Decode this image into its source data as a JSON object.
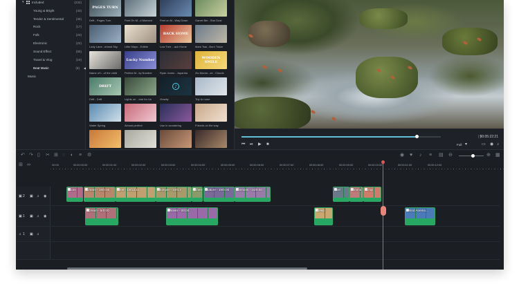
{
  "sidebar": {
    "items": [
      {
        "label": "Included",
        "count": "(232)"
      },
      {
        "label": "Young & Bright",
        "count": "(43)"
      },
      {
        "label": "Tender & Sentimental",
        "count": "(36)"
      },
      {
        "label": "Rock",
        "count": "(17)"
      },
      {
        "label": "Folk",
        "count": "(23)"
      },
      {
        "label": "Electronic",
        "count": "(22)"
      },
      {
        "label": "Sound Effect",
        "count": "(65)"
      },
      {
        "label": "Travel & Vlog",
        "count": "(19)"
      },
      {
        "label": "Beat Music",
        "count": "(8)"
      },
      {
        "label": "Music",
        "count": ""
      }
    ]
  },
  "media": {
    "tiles": [
      {
        "caption": "Drift - Pages Turn",
        "thumb_text": "PAGES TURN",
        "color": "#3a4a52",
        "color2": "#9fb2bc"
      },
      {
        "caption": "Feet On M...d Moment",
        "thumb_text": "",
        "color": "#5d6f7a",
        "color2": "#c8d3d8"
      },
      {
        "caption": "Feet on M...Way Down",
        "thumb_text": "",
        "color": "#2d3e5a",
        "color2": "#6a8ab0"
      },
      {
        "caption": "Garret Ber...Star Dust",
        "thumb_text": "",
        "color": "#6b8b5e",
        "color2": "#c9d0a0"
      },
      {
        "caption": "Lady Lane...erland Sky",
        "thumb_text": "",
        "color": "#4a5d72",
        "color2": "#9ab0c4"
      },
      {
        "caption": "Little Mayo - Edible",
        "thumb_text": "",
        "color": "#e8e0d0",
        "color2": "#a09080"
      },
      {
        "caption": "Low Tree ...ack Home",
        "thumb_text": "BACK HOME",
        "color": "#b83a2e",
        "color2": "#e8c8a0"
      },
      {
        "caption": "Mark Tsai...Born Twice",
        "thumb_text": "",
        "color": "#6a7a8a",
        "color2": "#c0b8a8"
      },
      {
        "caption": "Name of t...of the child",
        "thumb_text": "",
        "color": "#e8e4dc",
        "color2": "#6a6a6a"
      },
      {
        "caption": "Perfect M...ky Number",
        "thumb_text": "Lucky Number",
        "color": "#3a3f8a",
        "color2": "#8a8fd8"
      },
      {
        "caption": "Ryan Jones - Japanba",
        "thumb_text": "",
        "color": "#2a2e34",
        "color2": "#5a3e3e"
      },
      {
        "caption": "Zio Moran...ze - Clouds",
        "thumb_text": "WOODEN SMILE",
        "color": "#e0b43a",
        "color2": "#f4d87a"
      },
      {
        "caption": "Drift - Drift",
        "thumb_text": "DRIFT",
        "color": "#4a7a6a",
        "color2": "#a8c8b0"
      },
      {
        "caption": "Lights on ...ime for Us",
        "thumb_text": "",
        "color": "#3a4a3a",
        "color2": "#8aa88a"
      },
      {
        "caption": "Gravity",
        "thumb_text": "",
        "color": "#14202a",
        "color2": "#1c3440"
      },
      {
        "caption": "Trip to rome",
        "thumb_text": "",
        "color": "#a8b8c8",
        "color2": "#e0e6ea"
      },
      {
        "caption": "Water Spring",
        "thumb_text": "",
        "color": "#5a8ab0",
        "color2": "#d0e0ea"
      },
      {
        "caption": "Almost perfect",
        "thumb_text": "",
        "color": "#c86a7a",
        "color2": "#f0c8d0"
      },
      {
        "caption": "Use in wondering",
        "thumb_text": "",
        "color": "#2a2e5a",
        "color2": "#8a5a9a"
      },
      {
        "caption": "Friends on the way",
        "thumb_text": "",
        "color": "#c8a88a",
        "color2": "#f0e0d0"
      },
      {
        "caption": "",
        "thumb_text": "",
        "color": "#c8783a",
        "color2": "#f4c06a"
      },
      {
        "caption": "",
        "thumb_text": "",
        "color": "#a8a8a0",
        "color2": "#e0e0d8"
      },
      {
        "caption": "",
        "thumb_text": "",
        "color": "#6a4a3a",
        "color2": "#c89878"
      },
      {
        "caption": "",
        "thumb_text": "",
        "color": "#3a2a2a",
        "color2": "#a88868"
      }
    ]
  },
  "preview": {
    "timecode": "00:05:22:21",
    "quality": "Full",
    "brackets": "{     }",
    "progress": 0.88
  },
  "ruler": {
    "labels": [
      "00:00",
      "00:00:00:00",
      "00:00:01:00",
      "00:00:02:00",
      "00:00:03:00",
      "00:00:04:00",
      "00:00:05:00",
      "00:00:06:00",
      "00:00:07:00",
      "00:00:08:00",
      "00:00:09:00",
      "00:00:10:00",
      "00:00:11:00",
      "00:00:12:00"
    ]
  },
  "timeline": {
    "track_labels": [
      "2",
      "1",
      "1"
    ],
    "clips": [
      {
        "name": "Corn",
        "color": "#b06a8a"
      },
      {
        "name": "Cream - 19/0:00",
        "color": "#b8866a"
      },
      {
        "name": "Doe - 19/12:11",
        "color": "#c0a070"
      },
      {
        "name": "Bumper - 10/0:2",
        "color": "#a89a6a"
      },
      {
        "name": "Chen",
        "color": "#8a9a6a"
      },
      {
        "name": "Nature - 19/0:00",
        "color": "#7a6a9a"
      },
      {
        "name": "Lemons - 10/0:00",
        "color": "#9a7aa8"
      },
      {
        "name": "Sel",
        "color": "#6a7a8a"
      },
      {
        "name": "Emma",
        "color": "#c07a7a"
      },
      {
        "name": "Crop",
        "color": "#d07a6a"
      },
      {
        "name": "Cream - 5/0:00",
        "color": "#b0707a"
      },
      {
        "name": "Violets - 00:00",
        "color": "#9a6aa8"
      },
      {
        "name": "Deep",
        "color": "#c8a870"
      },
      {
        "name": "Wind Anemo...",
        "color": "#4a7ab8"
      }
    ]
  },
  "zoom": {
    "level": 0.55
  }
}
